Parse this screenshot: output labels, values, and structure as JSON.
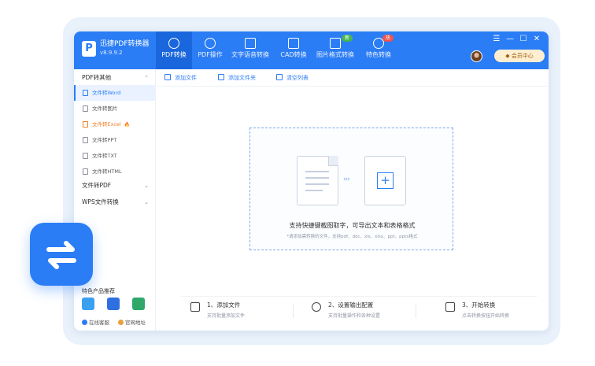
{
  "app": {
    "name": "迅捷PDF转换器",
    "version": "v8.9.9.2"
  },
  "colors": {
    "accent": "#2b7df5",
    "accent_dark": "#1a66dc",
    "hot": "#ef7b21",
    "vip_bg": "#ffeed0"
  },
  "tabs": [
    {
      "label": "PDF转换",
      "icon": "pdf-convert-icon",
      "active": true
    },
    {
      "label": "PDF操作",
      "icon": "pdf-operate-icon"
    },
    {
      "label": "文字语音转换",
      "icon": "voice-text-icon"
    },
    {
      "label": "CAD转换",
      "icon": "cad-icon"
    },
    {
      "label": "图片格式转换",
      "icon": "image-format-icon",
      "badge": "新"
    },
    {
      "label": "特色转换",
      "icon": "special-convert-icon",
      "badge": "热"
    }
  ],
  "window_controls": {
    "menu": "☰",
    "minimize": "—",
    "maximize": "☐",
    "close": "✕"
  },
  "vip": {
    "label": "会员中心"
  },
  "sidebar": {
    "groups": [
      {
        "label": "PDF转其他",
        "chevron": "⌃"
      },
      {
        "label": "文件转PDF",
        "chevron": "⌄"
      },
      {
        "label": "WPS文件转换",
        "chevron": "⌄"
      }
    ],
    "items": [
      {
        "label": "文件转Word",
        "active": true
      },
      {
        "label": "文件转图片"
      },
      {
        "label": "文件转Excel",
        "hot": true
      },
      {
        "label": "文件转PPT"
      },
      {
        "label": "文件转TXT"
      },
      {
        "label": "文件转HTML"
      }
    ],
    "hot_mark": "🔥",
    "recommend_title": "特色产品推荐",
    "footer": {
      "support": "在线客服",
      "website": "官网地址"
    }
  },
  "toolbar": {
    "add_file": "添加文件",
    "add_folder": "添加文件夹",
    "clear_list": "清空列表"
  },
  "dropzone": {
    "arrows": "›››",
    "plus": "+",
    "main_text": "支持快捷键截图取字，可导出文本和表格格式",
    "sub_text": "*请添加需转换的文件，支持pdf、doc、xls、xlsx、ppt、pptx格式"
  },
  "steps": [
    {
      "title": "1、添加文件",
      "desc": "支持批量添加文件",
      "icon": "add-file-icon"
    },
    {
      "title": "2、设置输出配置",
      "desc": "支持批量操作和各种设置",
      "icon": "settings-icon"
    },
    {
      "title": "3、开始转换",
      "desc": "点击转换按钮开始转换",
      "icon": "start-convert-icon"
    }
  ]
}
